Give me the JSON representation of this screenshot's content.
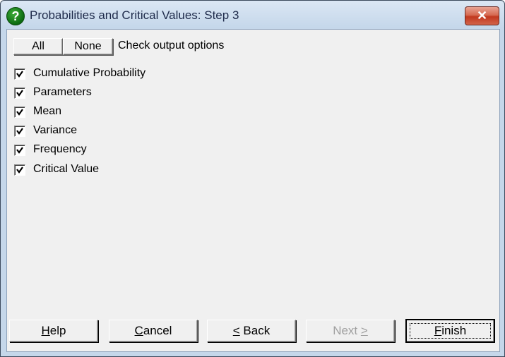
{
  "window": {
    "title": "Probabilities and Critical Values: Step 3",
    "app_icon": "question-icon",
    "close_icon": "✕"
  },
  "toolbar": {
    "all_label": "All",
    "none_label": "None",
    "hint": "Check output options"
  },
  "options": [
    {
      "label": "Cumulative Probability",
      "checked": true
    },
    {
      "label": "Parameters",
      "checked": true
    },
    {
      "label": "Mean",
      "checked": true
    },
    {
      "label": "Variance",
      "checked": true
    },
    {
      "label": "Frequency",
      "checked": true
    },
    {
      "label": "Critical Value",
      "checked": true
    }
  ],
  "footer": {
    "help": {
      "mnemonic": "H",
      "rest": "elp"
    },
    "cancel": {
      "mnemonic": "C",
      "rest": "ancel"
    },
    "back": {
      "mnemonic": "<",
      "rest": " Back"
    },
    "next": {
      "pre": "Next ",
      "mnemonic": ">",
      "enabled": false
    },
    "finish": {
      "mnemonic": "F",
      "rest": "inish"
    }
  }
}
